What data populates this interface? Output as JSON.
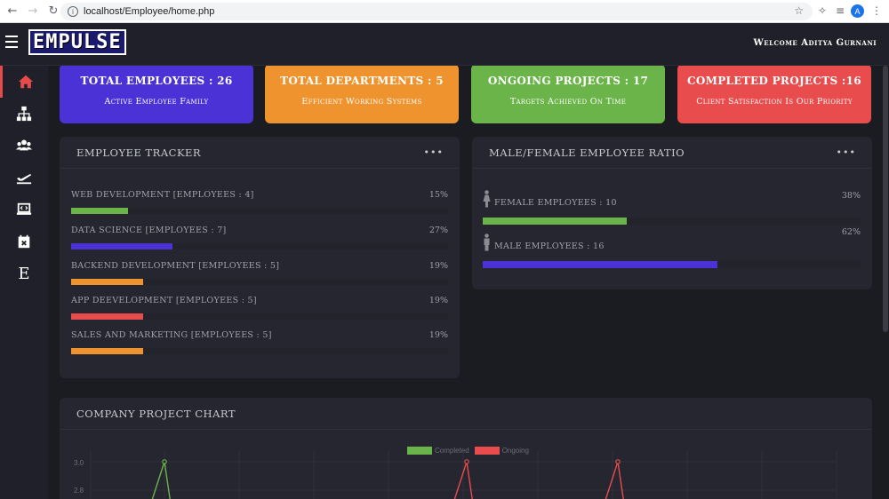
{
  "browser": {
    "url": "localhost/Employee/home.php",
    "avatar_letter": "A"
  },
  "header": {
    "logo": "EMPULSE",
    "welcome": "Welcome Aditya Gurnani"
  },
  "sidebar": {
    "items": [
      {
        "icon": "home-icon",
        "active": true
      },
      {
        "icon": "sitemap-icon",
        "active": false
      },
      {
        "icon": "users-icon",
        "active": false
      },
      {
        "icon": "plane-departure-icon",
        "active": false
      },
      {
        "icon": "laptop-code-icon",
        "active": false
      },
      {
        "icon": "calendar-times-icon",
        "active": false
      },
      {
        "icon": "e-letter-icon",
        "label": "E",
        "active": false
      }
    ]
  },
  "stats": [
    {
      "title": "TOTAL EMPLOYEES : 26",
      "subtitle": "Active Employee Family",
      "color": "#4b32d6"
    },
    {
      "title": "TOTAL DEPARTMENTS : 5",
      "subtitle": "Efficient Working Systems",
      "color": "#ef932e"
    },
    {
      "title": "ONGOING PROJECTS : 17",
      "subtitle": "Targets Achieved On Time",
      "color": "#6bb44a"
    },
    {
      "title": "COMPLETED PROJECTS :16",
      "subtitle": "Client Satisfaction Is Our Priority",
      "color": "#e84c4c"
    }
  ],
  "tracker": {
    "title": "EMPLOYEE TRACKER",
    "menu": "•••",
    "rows": [
      {
        "label": "WEB DEVELOPMENT [EMPLOYEES : 4]",
        "percent": "15%",
        "value": 15,
        "color": "#6bb44a"
      },
      {
        "label": "DATA SCIENCE [EMPLOYEES : 7]",
        "percent": "27%",
        "value": 27,
        "color": "#4b32d6"
      },
      {
        "label": "BACKEND DEVELOPMENT [EMPLOYEES : 5]",
        "percent": "19%",
        "value": 19,
        "color": "#ef932e"
      },
      {
        "label": "APP DEEVELOPMENT [EMPLOYEES : 5]",
        "percent": "19%",
        "value": 19,
        "color": "#e84c4c"
      },
      {
        "label": "SALES AND MARKETING [EMPLOYEES : 5]",
        "percent": "19%",
        "value": 19,
        "color": "#ef932e"
      }
    ]
  },
  "ratio": {
    "title": "MALE/FEMALE EMPLOYEE RATIO",
    "menu": "•••",
    "rows": [
      {
        "label": "FEMALE EMPLOYEES : 10",
        "percent": "38%",
        "value": 38,
        "color": "#6bb44a",
        "icon": "female-icon"
      },
      {
        "label": "MALE EMPLOYEES : 16",
        "percent": "62%",
        "value": 62,
        "color": "#4b32d6",
        "icon": "male-icon"
      }
    ]
  },
  "project_chart": {
    "title": "COMPANY PROJECT CHART",
    "chart_data": {
      "type": "line",
      "series": [
        {
          "name": "Completed",
          "color": "#6bb44a"
        },
        {
          "name": "Ongoing",
          "color": "#e84c4c"
        }
      ],
      "y_ticks": [
        "3.0",
        "2.8"
      ],
      "visible_peaks": [
        {
          "series": "Completed",
          "y": 3.0
        },
        {
          "series": "Ongoing",
          "y": 3.0
        },
        {
          "series": "Ongoing",
          "y": 3.0
        }
      ]
    }
  }
}
